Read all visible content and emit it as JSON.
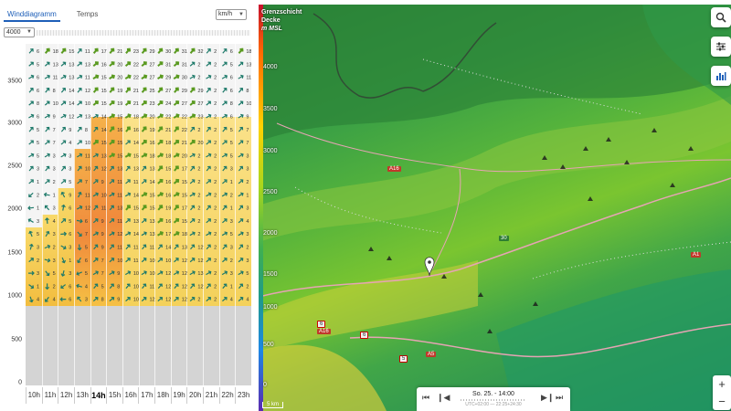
{
  "tabs": [
    {
      "label": "Winddiagramm",
      "active": true
    },
    {
      "label": "Temps",
      "active": false
    }
  ],
  "unit_select": {
    "value": "km/h"
  },
  "altitude_select": {
    "value": "4000"
  },
  "y_axis": {
    "ticks": [
      "3500",
      "3000",
      "2500",
      "2000",
      "1500",
      "1000",
      "500",
      "0"
    ],
    "max": 4000
  },
  "x_axis": {
    "ticks": [
      "10h",
      "11h",
      "12h",
      "13h",
      "14h",
      "15h",
      "16h",
      "17h",
      "18h",
      "19h",
      "20h",
      "21h",
      "22h",
      "23h"
    ],
    "active": "14h"
  },
  "wind_speeds": [
    [
      "6",
      "18",
      "15",
      "11",
      "17",
      "21",
      "23",
      "29",
      "30",
      "31",
      "32",
      "2"
    ],
    [
      "5",
      "13",
      "13",
      "13",
      "16",
      "20",
      "22",
      "27",
      "31",
      "31",
      "2",
      "2"
    ],
    [
      "6",
      "11",
      "13",
      "11",
      "15",
      "20",
      "22",
      "27",
      "29",
      "30",
      "2",
      "2"
    ],
    [
      "6",
      "8",
      "14",
      "12",
      "15",
      "19",
      "21",
      "25",
      "27",
      "29",
      "29",
      "2"
    ],
    [
      "8",
      "10",
      "14",
      "10",
      "15",
      "19",
      "21",
      "23",
      "24",
      "27",
      "27",
      "2"
    ],
    [
      "6",
      "9",
      "12",
      "13",
      "14",
      "15",
      "18",
      "20",
      "22",
      "22",
      "23",
      "2"
    ],
    [
      "5",
      "7",
      "9",
      "8",
      "14",
      "16",
      "16",
      "19",
      "21",
      "22",
      "2",
      "2"
    ],
    [
      "5",
      "7",
      "4",
      "10",
      "15",
      "15",
      "14",
      "16",
      "18",
      "21",
      "20",
      "2"
    ],
    [
      "5",
      "3",
      "3",
      "11",
      "13",
      "15",
      "15",
      "18",
      "18",
      "20",
      "2",
      "2"
    ],
    [
      "3",
      "3",
      "3",
      "10",
      "12",
      "13",
      "13",
      "13",
      "15",
      "17",
      "2",
      "2"
    ],
    [
      "1",
      "2",
      "5",
      "7",
      "9",
      "11",
      "11",
      "14",
      "16",
      "15",
      "2",
      "2"
    ],
    [
      "2",
      "1",
      "9",
      "11",
      "10",
      "11",
      "14",
      "15",
      "16",
      "15",
      "2",
      "2"
    ],
    [
      "1",
      "3",
      "6",
      "12",
      "11",
      "13",
      "15",
      "15",
      "19",
      "17",
      "2",
      "2"
    ],
    [
      "3",
      "4",
      "5",
      "6",
      "9",
      "11",
      "13",
      "13",
      "16",
      "15",
      "2",
      "2"
    ],
    [
      "5",
      "3",
      "6",
      "7",
      "9",
      "12",
      "14",
      "13",
      "17",
      "18",
      "2",
      "2"
    ],
    [
      "3",
      "2",
      "3",
      "5",
      "9",
      "11",
      "11",
      "11",
      "14",
      "13",
      "12",
      "2"
    ],
    [
      "2",
      "3",
      "1",
      "6",
      "7",
      "10",
      "11",
      "10",
      "10",
      "12",
      "12",
      "2"
    ],
    [
      "3",
      "5",
      "3",
      "5",
      "7",
      "9",
      "10",
      "10",
      "12",
      "12",
      "13",
      "2"
    ],
    [
      "1",
      "2",
      "6",
      "4",
      "5",
      "8",
      "10",
      "11",
      "12",
      "12",
      "12",
      "2"
    ],
    [
      "4",
      "4",
      "6",
      "3",
      "8",
      "9",
      "10",
      "12",
      "12",
      "12",
      "2",
      "2"
    ]
  ],
  "map": {
    "legend_title": [
      "Grenzschicht",
      "Decke",
      "m MSL"
    ],
    "legend_ticks": [
      "4000",
      "3500",
      "3000",
      "2500",
      "2000",
      "1500",
      "1000",
      "500",
      "0"
    ],
    "scale": "5 km",
    "road_labels": {
      "a16_top": "A16",
      "r30": "30",
      "a1": "A1",
      "r6": "6",
      "a16_bottom": "A16",
      "r6b": "6",
      "a5": "A5",
      "r5": "5"
    },
    "time_label": "So. 25. - 14:00",
    "time_sub": "UTC+02:00 — 22:25+24:30",
    "zoom_in": "+",
    "zoom_out": "−"
  },
  "colors": {
    "accent": "#1e5fb8",
    "boundary_layer": "#f08a3c"
  }
}
